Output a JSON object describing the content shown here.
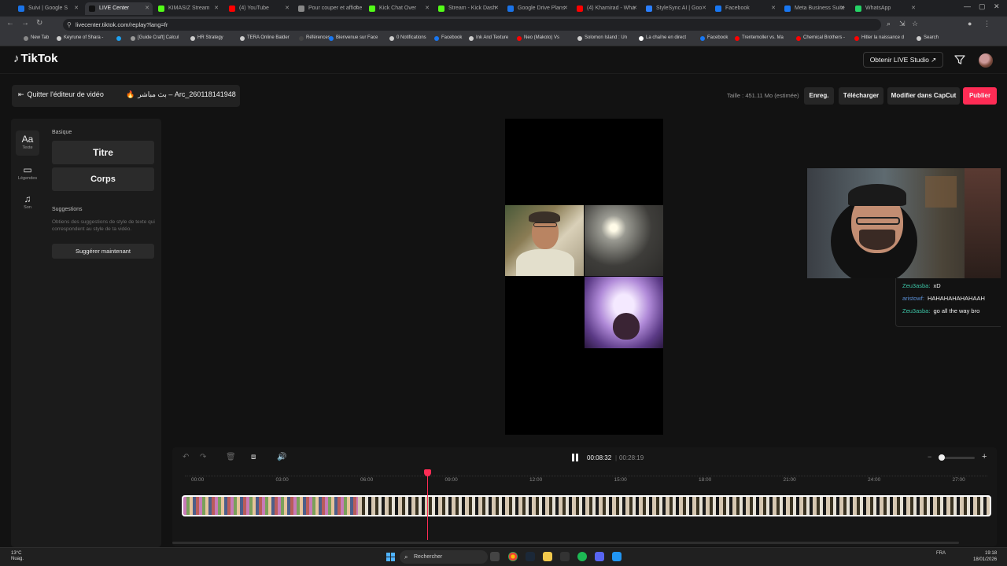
{
  "browser": {
    "tabs": [
      {
        "label": "Suivi | Google S",
        "color": "#1a73e8"
      },
      {
        "label": "LIVE Center",
        "color": "#111111",
        "active": true
      },
      {
        "label": "KIMASIZ Stream",
        "color": "#53fc18"
      },
      {
        "label": "(4) YouTube",
        "color": "#ff0000"
      },
      {
        "label": "Pour couper et afficher",
        "color": "#888888"
      },
      {
        "label": "Kick Chat Over",
        "color": "#53fc18"
      },
      {
        "label": "Stream - Kick Dash",
        "color": "#53fc18"
      },
      {
        "label": "Google Drive Plans",
        "color": "#1a73e8"
      },
      {
        "label": "(4) Khamirad - Wha",
        "color": "#ff0000"
      },
      {
        "label": "StyleSync AI | Goo",
        "color": "#2b7fff"
      },
      {
        "label": "Facebook",
        "color": "#1877f2"
      },
      {
        "label": "Meta Business Suite",
        "color": "#1877f2"
      },
      {
        "label": "WhatsApp",
        "color": "#25d366"
      }
    ],
    "url": "livecenter.tiktok.com/replay?lang=fr",
    "bookmarks": [
      {
        "label": "New Tab",
        "color": "#888888"
      },
      {
        "label": "Keyrune of Shara -",
        "color": "#cccccc"
      },
      {
        "label": "",
        "color": "#1da1f2"
      },
      {
        "label": "[Guide Craft] Calcul",
        "color": "#999999"
      },
      {
        "label": "HR Strategy",
        "color": "#cccccc"
      },
      {
        "label": "TERA Online Balder",
        "color": "#cccccc"
      },
      {
        "label": "Références",
        "color": "#444444"
      },
      {
        "label": "Bienvenue sur Face",
        "color": "#1877f2"
      },
      {
        "label": "0 Notifications",
        "color": "#cccccc"
      },
      {
        "label": "Facebook",
        "color": "#1877f2"
      },
      {
        "label": "Ink And Texture",
        "color": "#cccccc"
      },
      {
        "label": "Neo (Makoto) Vs",
        "color": "#ff0000"
      },
      {
        "label": "Solomon Island : Un",
        "color": "#cccccc"
      },
      {
        "label": "La chaîne en direct",
        "color": "#ffffff"
      },
      {
        "label": "Facebook",
        "color": "#1877f2"
      },
      {
        "label": "Trentemoller vs. Ma",
        "color": "#ff0000"
      },
      {
        "label": "Chemical Brothers -",
        "color": "#ff0000"
      },
      {
        "label": "Hitler la naissance d",
        "color": "#ff0000"
      },
      {
        "label": "Search",
        "color": "#cccccc"
      }
    ]
  },
  "header": {
    "logo": "TikTok",
    "live_studio": "Obtenir LIVE Studio ↗"
  },
  "editor": {
    "quit": "Quitter l'éditeur de vidéo",
    "video_name": "بث مباشر – Arc_260118141948",
    "size": "Taille : 451.11 Mo (estimée)",
    "save": "Enreg.",
    "download": "Télécharger",
    "capcut": "Modifier dans CapCut",
    "publish": "Publier"
  },
  "left_panel": {
    "tabs": [
      {
        "icon": "Aa",
        "label": "Texte"
      },
      {
        "icon": "▭",
        "label": "Légendes"
      },
      {
        "icon": "♫",
        "label": "Son"
      }
    ],
    "basic_heading": "Basique",
    "title_btn": "Titre",
    "body_btn": "Corps",
    "suggestions_heading": "Suggestions",
    "suggestions_desc": "Obtiens des suggestions de style de texte qui correspondent au style de ta vidéo.",
    "suggest_btn": "Suggérer maintenant"
  },
  "chat": [
    {
      "user": "Zeu3asba:",
      "msg": "xD",
      "color": "#3cc3a5"
    },
    {
      "user": "aristowf:",
      "msg": "HAHAHAHAHAHAAH",
      "color": "#5b8fd6"
    },
    {
      "user": "Zeu3asba:",
      "msg": "go all the way bro",
      "color": "#3cc3a5"
    }
  ],
  "timeline": {
    "current_time": "00:08:32",
    "total_time": "00:28:19",
    "separator": "|",
    "ticks": [
      "00:00",
      "03:00",
      "06:00",
      "09:00",
      "12:00",
      "15:00",
      "18:00",
      "21:00",
      "24:00",
      "27:00"
    ]
  },
  "taskbar": {
    "weather": "13°C",
    "weather_sub": "Nuag.",
    "search": "Rechercher",
    "lang": "FRA",
    "time": "19:18",
    "date": "18/01/2026"
  }
}
